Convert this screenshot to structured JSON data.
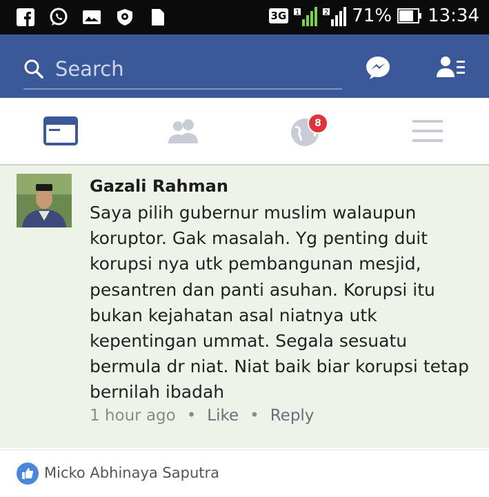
{
  "status_bar": {
    "icons": [
      "facebook-icon",
      "whatsapp-icon",
      "gallery-icon",
      "vpn-shield-icon",
      "sim-card-icon"
    ],
    "network_label": "3G",
    "sim1_label": "1",
    "sim2_label": "2",
    "battery_percent": "71%",
    "time": "13:34"
  },
  "header": {
    "search_placeholder": "Search",
    "accent_color": "#3b5998"
  },
  "tabs": {
    "items": [
      {
        "name": "news-feed",
        "active": true
      },
      {
        "name": "friends",
        "active": false
      },
      {
        "name": "notifications",
        "active": false,
        "badge": "8"
      },
      {
        "name": "menu",
        "active": false
      }
    ]
  },
  "comment": {
    "author": "Gazali Rahman",
    "lines": [
      "Saya pilih gubernur muslim walaupun",
      "koruptor. Gak masalah. Yg penting duit",
      "korupsi nya utk pembangunan mesjid,",
      "pesantren dan panti asuhan. Korupsi itu",
      "bukan kejahatan asal niatnya utk",
      "kepentingan ummat. Segala sesuatu",
      "bermula dr niat. Niat baik biar korupsi tetap",
      "bernilah ibadah"
    ],
    "time": "1 hour ago",
    "like_label": "Like",
    "reply_label": "Reply"
  },
  "footer": {
    "liker_name": "Micko Abhinaya Saputra"
  }
}
